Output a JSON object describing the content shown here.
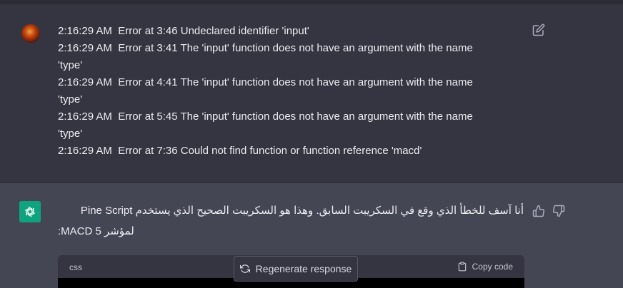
{
  "user_message": {
    "lines": [
      "2:16:29 AM  Error at 3:46 Undeclared identifier 'input'",
      "2:16:29 AM  Error at 3:41 The 'input' function does not have an argument with the name",
      "'type'",
      "2:16:29 AM  Error at 4:41 The 'input' function does not have an argument with the name",
      "'type'",
      "2:16:29 AM  Error at 5:45 The 'input' function does not have an argument with the name",
      "'type'",
      "2:16:29 AM  Error at 7:36 Could not find function or function reference 'macd'"
    ],
    "edit_icon": "edit-icon"
  },
  "assistant_message": {
    "line1": "أنا آسف للخطأ الذي وقع في السكريبت السابق. وهذا هو السكريبت الصحيح الذي يستخدم Pine Script",
    "line2": "لمؤشر 5 MACD:",
    "feedback_icons": [
      "thumbs-up-icon",
      "thumbs-down-icon"
    ]
  },
  "code_block": {
    "language": "css",
    "copy_label": "Copy code"
  },
  "regenerate": {
    "label": "Regenerate response"
  },
  "colors": {
    "background": "#343541",
    "assistant_bg": "#444654",
    "openai_green": "#10a37f"
  }
}
